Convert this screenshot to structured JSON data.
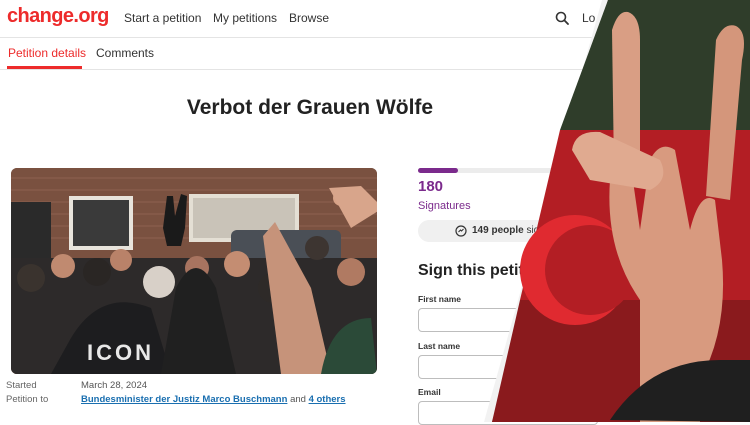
{
  "header": {
    "logo": "change.org",
    "nav": [
      "Start a petition",
      "My petitions",
      "Browse"
    ],
    "login_label": "Lo"
  },
  "tabs": [
    "Petition details",
    "Comments"
  ],
  "petition": {
    "title": "Verbot der Grauen Wölfe",
    "photo_shirt_text": "ICON",
    "started_label": "Started",
    "started_value": "March 28, 2024",
    "petition_to_label": "Petition to",
    "petition_to_value": "Bundesminister der Justiz Marco Buschmann",
    "petition_to_and": "and",
    "petition_to_others": "4 others"
  },
  "signatures": {
    "count": "180",
    "label": "Signatures",
    "progress_fraction": 0.2,
    "recent_count": "149 people",
    "recent_rest": "sig"
  },
  "form": {
    "title": "Sign this petit",
    "first_name_label": "First name",
    "last_name_label": "Last name",
    "email_label": "Email"
  },
  "colors": {
    "brand": "#ed2b2b",
    "signature": "#7b2a8c",
    "link": "#1a6fb0"
  },
  "icons": [
    "search-icon",
    "hand-signature-icon"
  ]
}
